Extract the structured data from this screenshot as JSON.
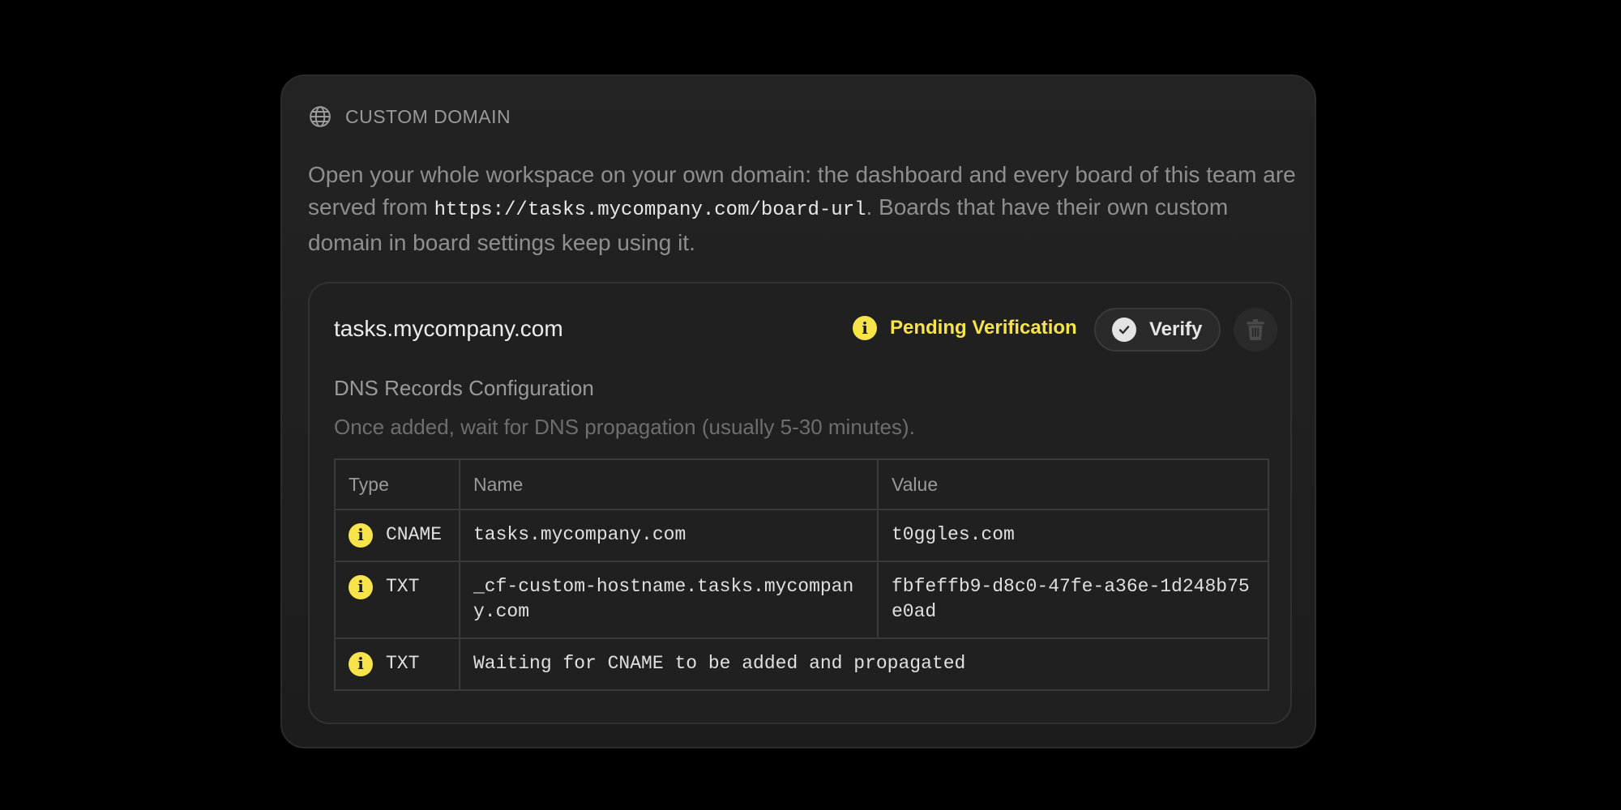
{
  "section": {
    "title": "CUSTOM DOMAIN",
    "desc_before": "Open your whole workspace on your own domain: the dashboard and every board of this team are served from ",
    "desc_url": "https://tasks.mycompany.com/board-url",
    "desc_after": ". Boards that have their own custom domain in board settings keep using it."
  },
  "domain": {
    "name": "tasks.mycompany.com",
    "status": "Pending Verification",
    "status_color": "#f7e34a",
    "verify_label": "Verify",
    "delete_icon": "trash-icon"
  },
  "dns": {
    "title": "DNS Records Configuration",
    "subtitle": "Once added, wait for DNS propagation (usually 5-30 minutes).",
    "columns": [
      "Type",
      "Name",
      "Value"
    ],
    "rows": [
      {
        "type": "CNAME",
        "name": "tasks.mycompany.com",
        "value": "t0ggles.com"
      },
      {
        "type": "TXT",
        "name": "_cf-custom-hostname.tasks.mycompany.com",
        "value": "fbfeffb9-d8c0-47fe-a36e-1d248b75e0ad"
      },
      {
        "type": "TXT",
        "message": "Waiting for CNAME to be added and propagated"
      }
    ]
  }
}
